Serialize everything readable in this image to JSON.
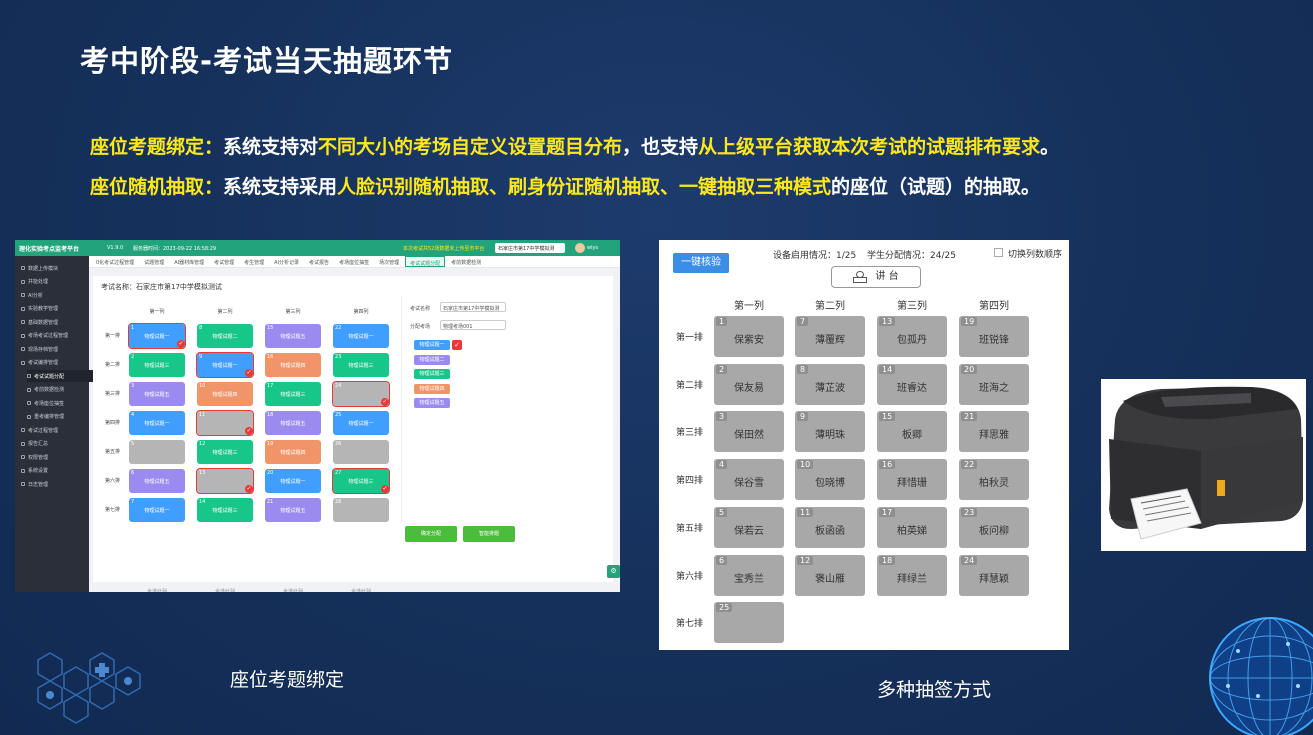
{
  "slide": {
    "title": "考中阶段-考试当天抽题环节",
    "line1": {
      "label": "座位考题绑定：",
      "t1": "系统支持对",
      "h1": "不同大小的考场自定义设置题目分布",
      "t2": "，也支持",
      "h2": "从上级平台获取本次考试的试题排布要求",
      "t3": "。"
    },
    "line2": {
      "label": "座位随机抽取：",
      "t1": "系统支持采用",
      "h1": "人脸识别随机抽取、刷身份证随机抽取、一键抽取三种模式",
      "t2": "的座位（试题）的抽取。"
    },
    "caption_left": "座位考题绑定",
    "caption_right": "多种抽签方式",
    "accent_color": "#ffe81a",
    "bg_color": "#17315c"
  },
  "app": {
    "brand": "理化实验考点监考平台",
    "version": "V1.9.0",
    "server_time": "服务器时间：2023-09-22 16:58:29",
    "notice": "本次考试共52场数据未上传至市平台",
    "school": "石家庄市第17中学模拟测",
    "user": "wlys",
    "sidebar": [
      "数据上传模块",
      "并能处理",
      "AI分析",
      "实验教学管理",
      "基础数据管理",
      "考场考试过程管理",
      "现场存档管理",
      "考试编排管理",
      "考试试题分配",
      "考前数据检测",
      "考场座位抽签",
      "重考编排管理",
      "考试过程管理",
      "报告汇总",
      "权限管理",
      "系统设置",
      "日志管理"
    ],
    "tabs": [
      "0化考试过程管理",
      "试题管理",
      "AI器材库管理",
      "考试管理",
      "考生管理",
      "AI分析记录",
      "考试报告",
      "考场座位抽签",
      "场次管理",
      "考试试题分配",
      "考前数据检测"
    ],
    "exam_label": "考试名称：石家庄市第17中学模拟测试",
    "cols": [
      "第一列",
      "第二列",
      "第三列",
      "第四列"
    ],
    "rows": [
      "第一排",
      "第二排",
      "第三排",
      "第四排",
      "第五排",
      "第六排",
      "第七排"
    ],
    "seats": [
      {
        "n": "1",
        "label": "物理试题一",
        "color": "blue",
        "checked": true
      },
      {
        "n": "8",
        "label": "物理试题二",
        "color": "green",
        "checked": false
      },
      {
        "n": "15",
        "label": "物理试题五",
        "color": "purple",
        "checked": false
      },
      {
        "n": "22",
        "label": "物理试题一",
        "color": "blue",
        "checked": false
      },
      {
        "n": "2",
        "label": "物理试题三",
        "color": "green",
        "checked": false
      },
      {
        "n": "9",
        "label": "物理试题一",
        "color": "blue",
        "checked": true
      },
      {
        "n": "16",
        "label": "物理试题四",
        "color": "orange",
        "checked": false
      },
      {
        "n": "23",
        "label": "物理试题三",
        "color": "green",
        "checked": false
      },
      {
        "n": "3",
        "label": "物理试题五",
        "color": "purple",
        "checked": false
      },
      {
        "n": "10",
        "label": "物理试题四",
        "color": "orange",
        "checked": false
      },
      {
        "n": "17",
        "label": "物理试题三",
        "color": "green",
        "checked": false
      },
      {
        "n": "24",
        "label": "",
        "color": "grey",
        "checked": true
      },
      {
        "n": "4",
        "label": "物理试题一",
        "color": "blue",
        "checked": false
      },
      {
        "n": "11",
        "label": "",
        "color": "grey",
        "checked": true
      },
      {
        "n": "18",
        "label": "物理试题五",
        "color": "purple",
        "checked": false
      },
      {
        "n": "25",
        "label": "物理试题一",
        "color": "blue",
        "checked": false
      },
      {
        "n": "5",
        "label": "",
        "color": "grey",
        "checked": false
      },
      {
        "n": "12",
        "label": "物理试题三",
        "color": "green",
        "checked": false
      },
      {
        "n": "19",
        "label": "物理试题四",
        "color": "orange",
        "checked": false
      },
      {
        "n": "26",
        "label": "",
        "color": "grey",
        "checked": false
      },
      {
        "n": "6",
        "label": "物理试题五",
        "color": "purple",
        "checked": false
      },
      {
        "n": "13",
        "label": "",
        "color": "grey",
        "checked": true
      },
      {
        "n": "20",
        "label": "物理试题一",
        "color": "blue",
        "checked": false
      },
      {
        "n": "27",
        "label": "物理试题三",
        "color": "green",
        "checked": true
      },
      {
        "n": "7",
        "label": "物理试题一",
        "color": "blue",
        "checked": false
      },
      {
        "n": "14",
        "label": "物理试题三",
        "color": "green",
        "checked": false
      },
      {
        "n": "21",
        "label": "物理试题五",
        "color": "purple",
        "checked": false
      },
      {
        "n": "28",
        "label": "",
        "color": "grey",
        "checked": false
      }
    ],
    "select_all": "全选此列",
    "panel": {
      "exam_name_label": "考试名称",
      "exam_name_value": "石家庄市第17中学模拟测",
      "room_label": "分配考场",
      "room_value": "物理考场001",
      "tags": [
        {
          "label": "物理试题一",
          "color": "blue"
        },
        {
          "label": "物理试题二",
          "color": "purple"
        },
        {
          "label": "物理试题三",
          "color": "green"
        },
        {
          "label": "物理试题四",
          "color": "orange"
        },
        {
          "label": "物理试题五",
          "color": "purple"
        }
      ]
    },
    "btn_confirm": "确定分配",
    "btn_smart": "智能排题"
  },
  "lottery": {
    "oneclick": "一键核验",
    "device_status": "设备启用情况：1/25",
    "student_status": "学生分配情况：24/25",
    "toggle_label": "切换列数顺序",
    "podium": "讲 台",
    "cols": [
      "第一列",
      "第二列",
      "第三列",
      "第四列"
    ],
    "rows": [
      "第一排",
      "第二排",
      "第三排",
      "第四排",
      "第五排",
      "第六排",
      "第七排"
    ],
    "seats": [
      [
        {
          "n": "1",
          "name": "保紫安"
        },
        {
          "n": "7",
          "name": "薄覆辉"
        },
        {
          "n": "13",
          "name": "包孤丹"
        },
        {
          "n": "19",
          "name": "班锐锋"
        }
      ],
      [
        {
          "n": "2",
          "name": "保友易"
        },
        {
          "n": "8",
          "name": "薄芷波"
        },
        {
          "n": "14",
          "name": "班睿达"
        },
        {
          "n": "20",
          "name": "班海之"
        }
      ],
      [
        {
          "n": "3",
          "name": "保田然"
        },
        {
          "n": "9",
          "name": "薄明珠"
        },
        {
          "n": "15",
          "name": "板卿"
        },
        {
          "n": "21",
          "name": "拜思雅"
        }
      ],
      [
        {
          "n": "4",
          "name": "保谷雪"
        },
        {
          "n": "10",
          "name": "包晓博"
        },
        {
          "n": "16",
          "name": "拜惜珊"
        },
        {
          "n": "22",
          "name": "柏秋灵"
        }
      ],
      [
        {
          "n": "5",
          "name": "保若云"
        },
        {
          "n": "11",
          "name": "板函函"
        },
        {
          "n": "17",
          "name": "柏英娣"
        },
        {
          "n": "23",
          "name": "板问柳"
        }
      ],
      [
        {
          "n": "6",
          "name": "宝秀兰"
        },
        {
          "n": "12",
          "name": "褒山雁"
        },
        {
          "n": "18",
          "name": "拜绿兰"
        },
        {
          "n": "24",
          "name": "拜慧颖"
        }
      ],
      [
        {
          "n": "25",
          "name": ""
        }
      ]
    ],
    "seat_color": "#a8a8a8",
    "button_color": "#3a8ee6"
  },
  "icons": {
    "printer": "label-printer-icon",
    "podium": "podium-icon",
    "globe": "globe-decoration-icon",
    "medical": "hexagon-medical-decoration-icon"
  }
}
